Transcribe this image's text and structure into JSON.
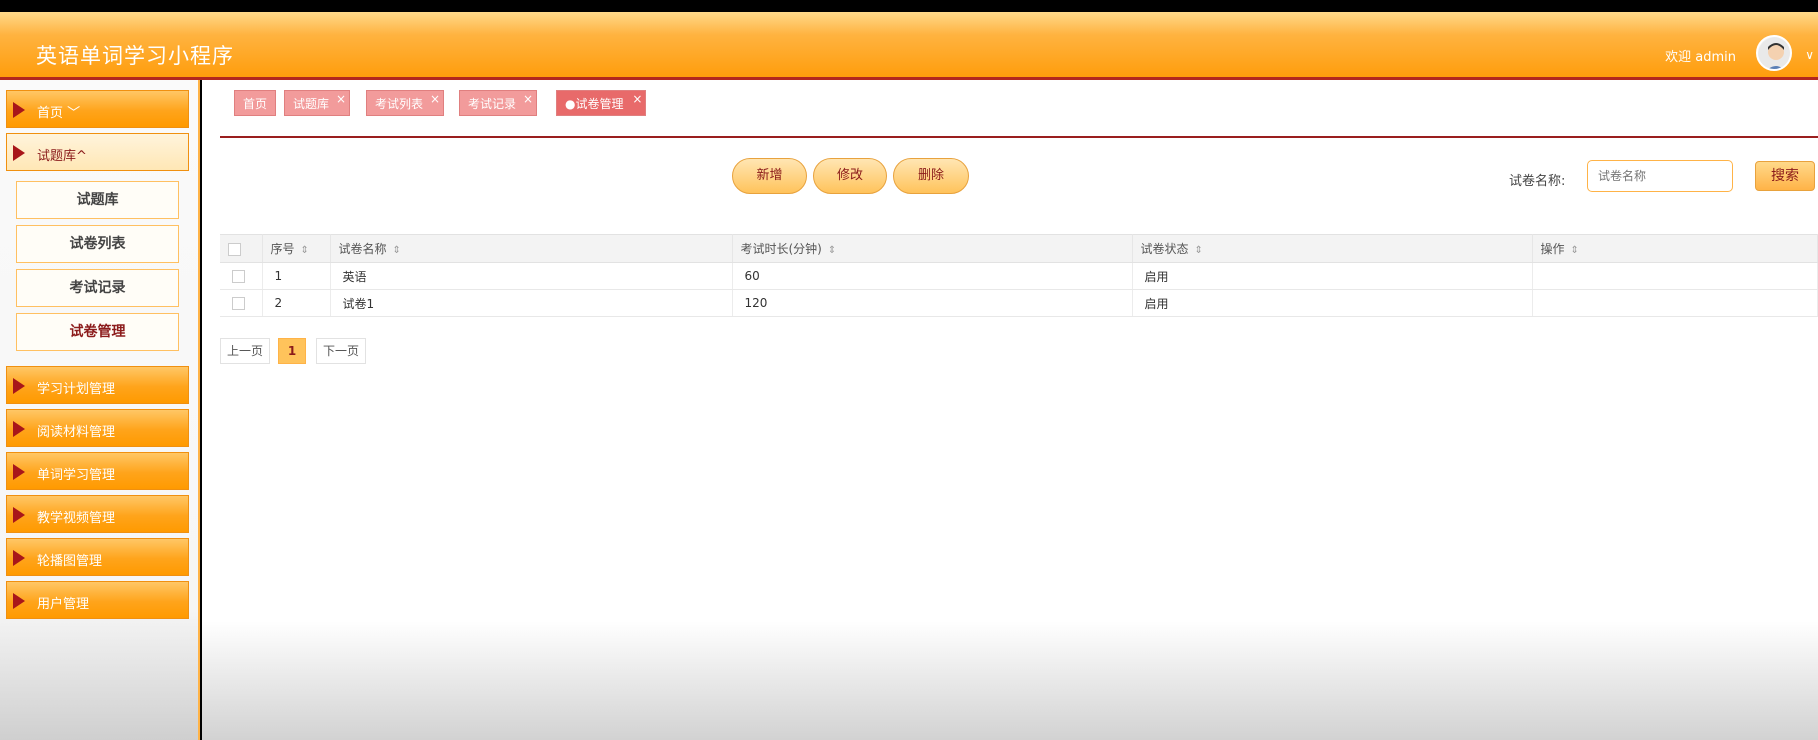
{
  "header": {
    "title": "英语单词学习小程序",
    "welcome": "欢迎 admin"
  },
  "sidebar": {
    "menus": [
      {
        "label": "首页 ﹀"
      },
      {
        "label": "试题库^"
      },
      {
        "label": "学习计划管理"
      },
      {
        "label": "阅读材料管理"
      },
      {
        "label": "单词学习管理"
      },
      {
        "label": "教学视频管理"
      },
      {
        "label": "轮播图管理"
      },
      {
        "label": "用户管理"
      }
    ],
    "submenus": [
      {
        "label": "试题库"
      },
      {
        "label": "试卷列表"
      },
      {
        "label": "考试记录"
      },
      {
        "label": "试卷管理"
      }
    ]
  },
  "tabs": [
    {
      "label": "首页"
    },
    {
      "label": "试题库"
    },
    {
      "label": "考试列表"
    },
    {
      "label": "考试记录"
    },
    {
      "label": "●试卷管理"
    }
  ],
  "tab_close": "×",
  "actions": {
    "add": "新增",
    "edit": "修改",
    "delete": "删除"
  },
  "search": {
    "label": "试卷名称:",
    "placeholder": "试卷名称",
    "button": "搜索"
  },
  "table": {
    "headers": [
      "序号",
      "试卷名称",
      "考试时长(分钟)",
      "试卷状态",
      "操作"
    ],
    "rows": [
      {
        "no": "1",
        "name": "英语",
        "duration": "60",
        "status": "启用",
        "op": ""
      },
      {
        "no": "2",
        "name": "试卷1",
        "duration": "120",
        "status": "启用",
        "op": ""
      }
    ]
  },
  "pagination": {
    "prev": "上一页",
    "current": "1",
    "next": "下一页"
  },
  "colors": {
    "header": "#ff9d0c",
    "accent": "#b2271e",
    "tab": "#f29b9b"
  }
}
